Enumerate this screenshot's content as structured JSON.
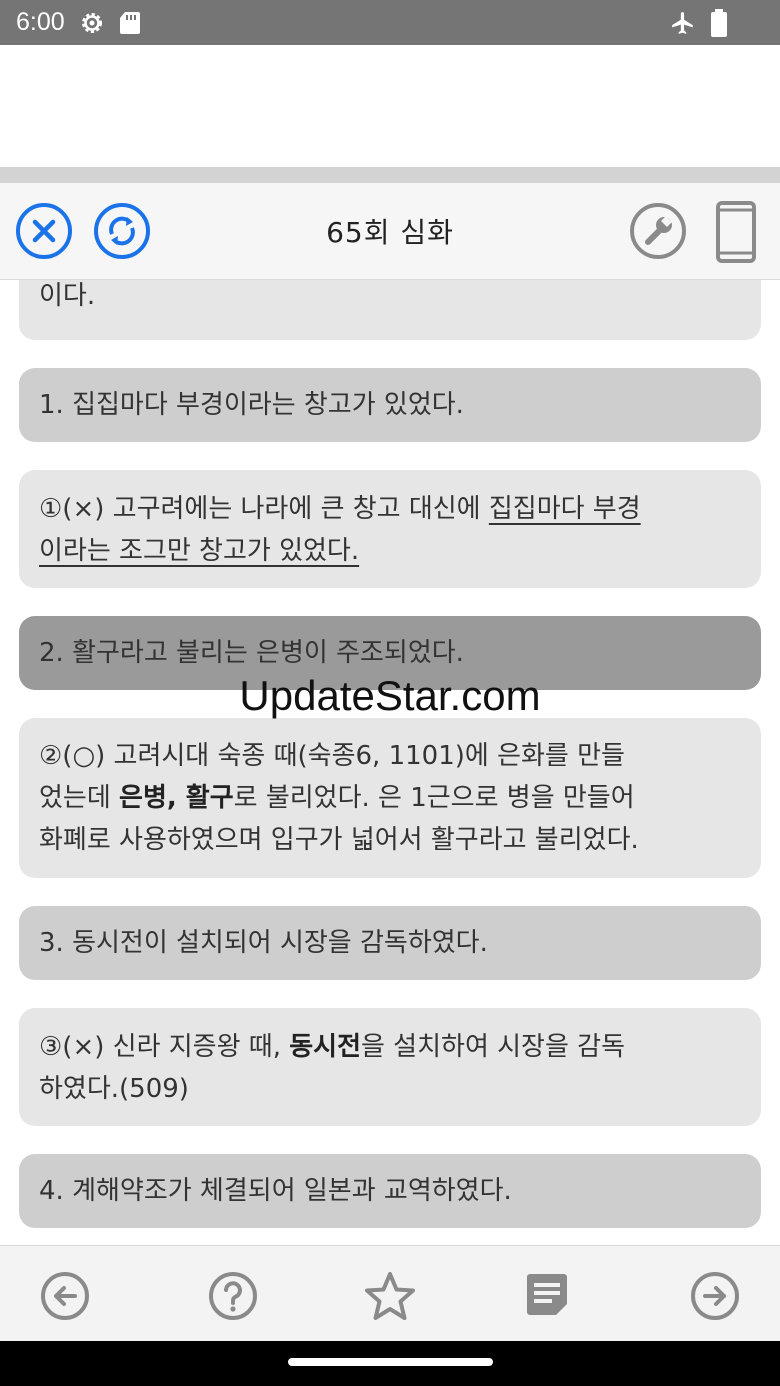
{
  "status_bar": {
    "time": "6:00"
  },
  "header": {
    "title": "65회 심화"
  },
  "cards": {
    "partial_top": "이다.",
    "q1": "1. 집집마다 부경이라는 창고가 있었다.",
    "a1_prefix": "①(×) 고구려에는 나라에 큰 창고 대신에 ",
    "a1_underline_1": "집집마다 부경",
    "a1_underline_2": "이라는 조그만 창고가 있었다.",
    "q2": "2. 활구라고 불리는 은병이 주조되었다.",
    "a2_line1": "②(○) 고려시대 숙종 때(숙종6, 1101)에 은화를 만들",
    "a2_line2_pre": "었는데 ",
    "a2_line2_bold": "은병, 활구",
    "a2_line2_post": "로 불리었다. 은 1근으로 병을 만들어",
    "a2_line3": "화폐로 사용하였으며 입구가 넓어서 활구라고 불리었다.",
    "q3": "3. 동시전이 설치되어 시장을 감독하였다.",
    "a3_line1_pre": "③(×) 신라 지증왕 때, ",
    "a3_line1_bold": "동시전",
    "a3_line1_post": "을 설치하여 시장을 감독",
    "a3_line2": "하였다.(509)",
    "q4": "4. 계해약조가 체결되어 일본과 교역하였다."
  },
  "watermark": "UpdateStar.com",
  "icons": {
    "close": "close-icon",
    "refresh": "refresh-icon",
    "settings": "wrench-icon",
    "device": "phone-icon",
    "prev": "arrow-left-icon",
    "help": "question-icon",
    "favorite": "star-icon",
    "notes": "note-icon",
    "next": "arrow-right-icon"
  },
  "colors": {
    "accent": "#1a73e8",
    "icon_gray": "#8a8a8a"
  }
}
